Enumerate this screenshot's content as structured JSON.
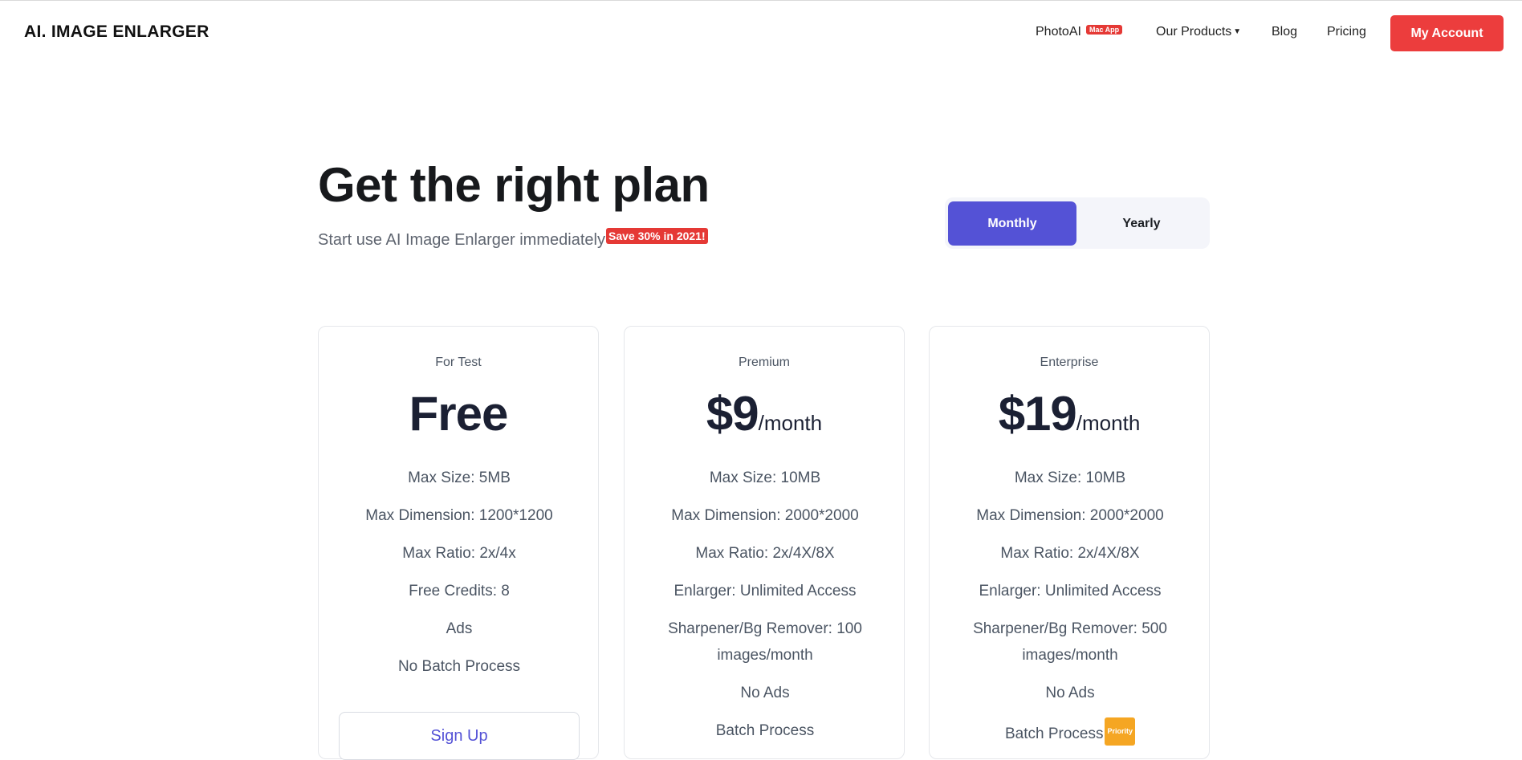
{
  "header": {
    "logo": "AI. IMAGE ENLARGER",
    "nav": {
      "photoai": "PhotoAI",
      "photoai_badge": "Mac App",
      "products": "Our Products",
      "blog": "Blog",
      "pricing": "Pricing"
    },
    "account_button": "My Account"
  },
  "hero": {
    "title": "Get the right plan",
    "subtitle": "Start use AI Image Enlarger immediately",
    "badge": "Save 30% in 2021!"
  },
  "billing_toggle": {
    "monthly": "Monthly",
    "yearly": "Yearly",
    "selected": "Monthly"
  },
  "plans": [
    {
      "tier": "For Test",
      "price": "Free",
      "period": "",
      "features": [
        "Max Size: 5MB",
        "Max Dimension: 1200*1200",
        "Max Ratio: 2x/4x",
        "Free Credits: 8",
        "Ads",
        "No Batch Process"
      ],
      "cta": "Sign Up"
    },
    {
      "tier": "Premium",
      "price": "$9",
      "period": "/month",
      "features": [
        "Max Size: 10MB",
        "Max Dimension: 2000*2000",
        "Max Ratio: 2x/4X/8X",
        "Enlarger: Unlimited Access",
        "Sharpener/Bg Remover: 100 images/month",
        "No Ads",
        "Batch Process"
      ]
    },
    {
      "tier": "Enterprise",
      "price": "$19",
      "period": "/month",
      "features": [
        "Max Size: 10MB",
        "Max Dimension: 2000*2000",
        "Max Ratio: 2x/4X/8X",
        "Enlarger: Unlimited Access",
        "Sharpener/Bg Remover: 500 images/month",
        "No Ads",
        "Batch Process"
      ],
      "priority_badge": "Priority"
    }
  ],
  "colors": {
    "accent": "#5452d6",
    "brand_red": "#ec3d3d",
    "priority": "#f5a623"
  }
}
